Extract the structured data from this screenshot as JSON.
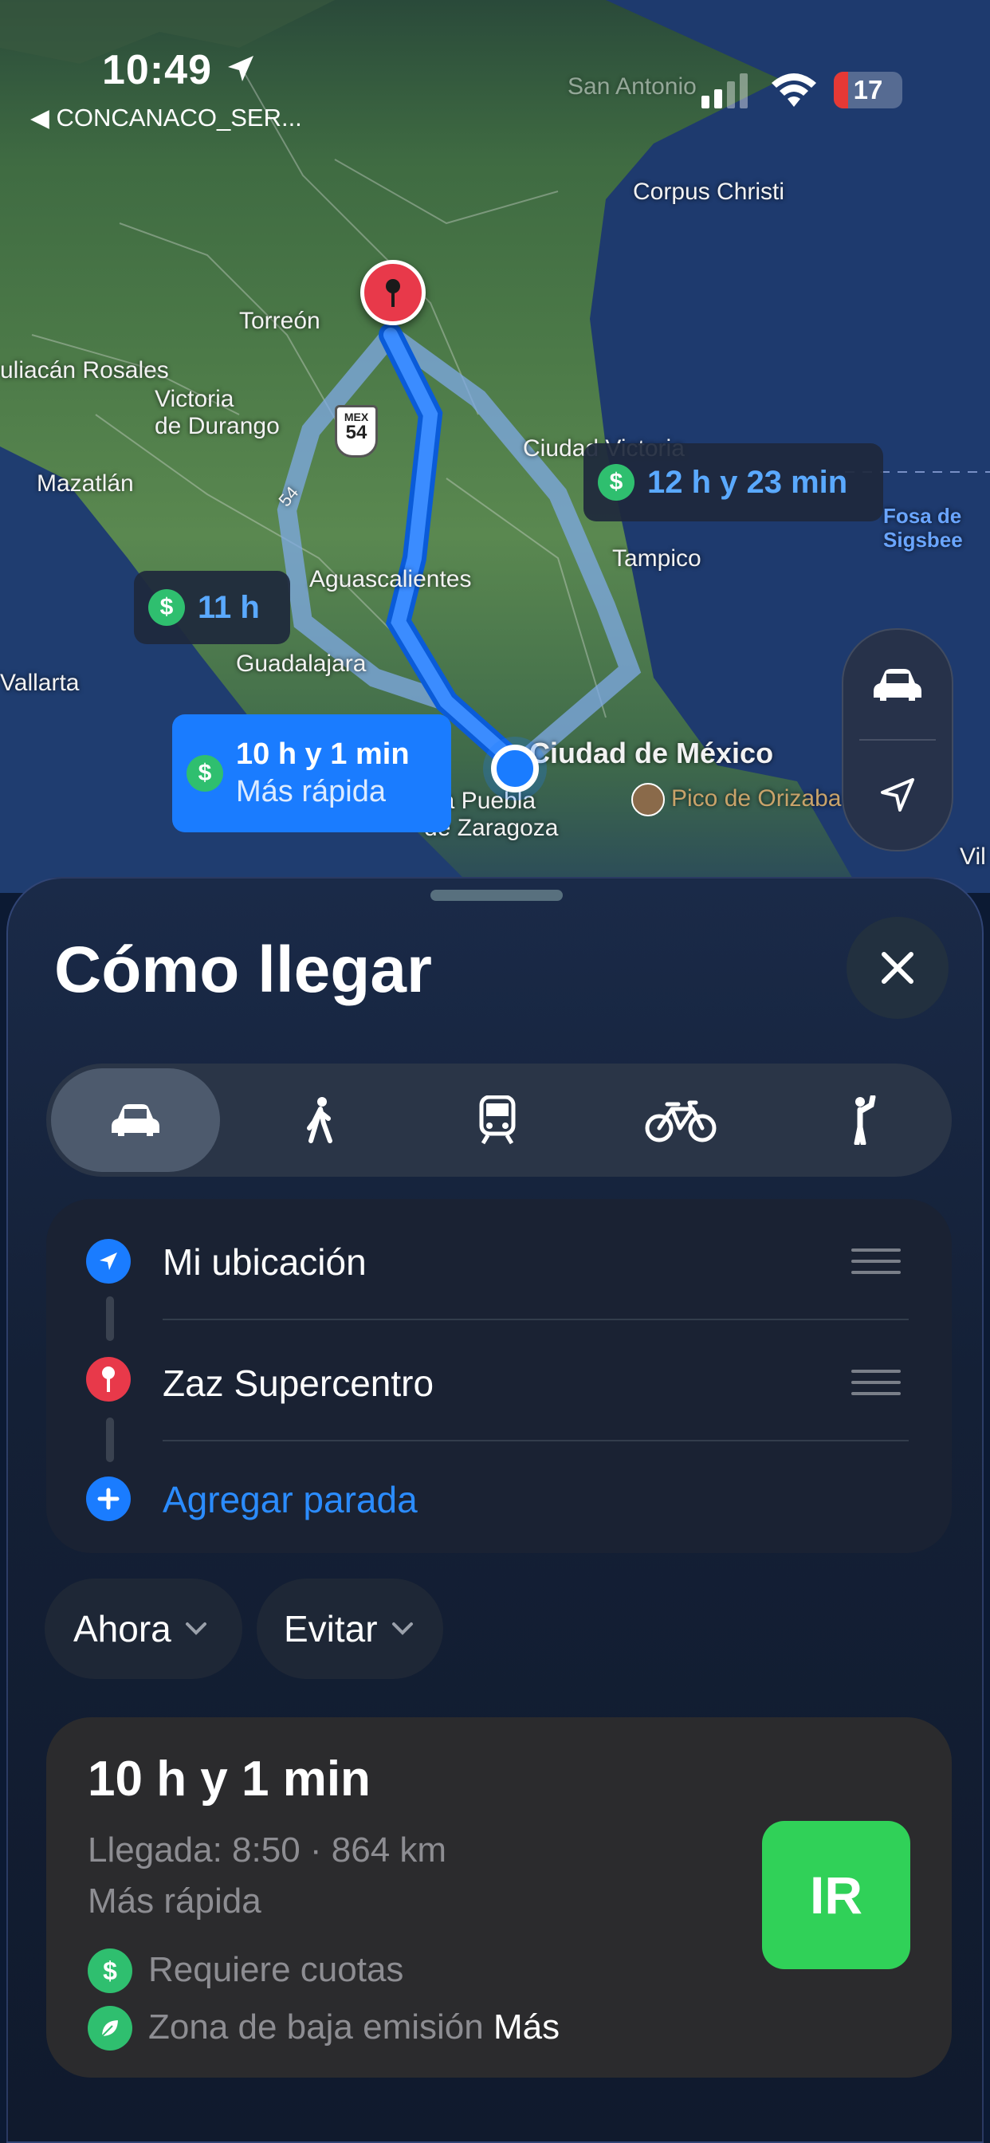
{
  "status_bar": {
    "time": "10:49",
    "back_label": "◀ CONCANACO_SER...",
    "battery": "17"
  },
  "map": {
    "labels": {
      "corpus_christi": "Corpus Christi",
      "torreon": "Torreón",
      "culiacan": "uliacán Rosales",
      "victoria_durango": "Victoria\nde Durango",
      "mazatlan": "Mazatlán",
      "ciudad_victoria": "Ciudad Victoria",
      "fosa": "Fosa de\nSigsbee",
      "aguascalientes": "Aguascalientes",
      "tampico": "Tampico",
      "vallarta": "Vallarta",
      "guadalajara": "Guadalajara",
      "cdmx": "Ciudad de México",
      "puebla": "ica Puebla\nde Zaragoza",
      "pico": "Pico de Orizaba",
      "vil": "Vil",
      "san_antonio": "San Antonio",
      "highway_shield_top": "MEX",
      "highway_shield_num": "54",
      "highway_54": "54"
    },
    "routes": [
      {
        "time": "12 h y 23 min"
      },
      {
        "time": "11 h"
      },
      {
        "time": "10 h y 1 min",
        "note": "Más rápida",
        "selected": true
      }
    ],
    "controls": [
      {
        "icon": "car-icon"
      },
      {
        "icon": "location-arrow-icon"
      }
    ]
  },
  "sheet": {
    "title": "Cómo llegar",
    "modes": [
      {
        "name": "car",
        "selected": true
      },
      {
        "name": "walk"
      },
      {
        "name": "transit"
      },
      {
        "name": "bike"
      },
      {
        "name": "rideshare"
      }
    ],
    "stops": {
      "origin": "Mi ubicación",
      "destination": "Zaz Supercentro",
      "add_stop": "Agregar parada"
    },
    "filters": {
      "time": "Ahora",
      "avoid": "Evitar"
    },
    "route_card": {
      "duration": "10 h y 1 min",
      "arrival": "Llegada: 8:50 · 864 km",
      "tag": "Más rápida",
      "tolls": "Requiere cuotas",
      "low_emission": "Zona de baja emisión",
      "more": "Más",
      "go": "IR"
    }
  },
  "colors": {
    "accent": "#1a7cff",
    "go": "#30d158",
    "route": "#3b82f6"
  }
}
